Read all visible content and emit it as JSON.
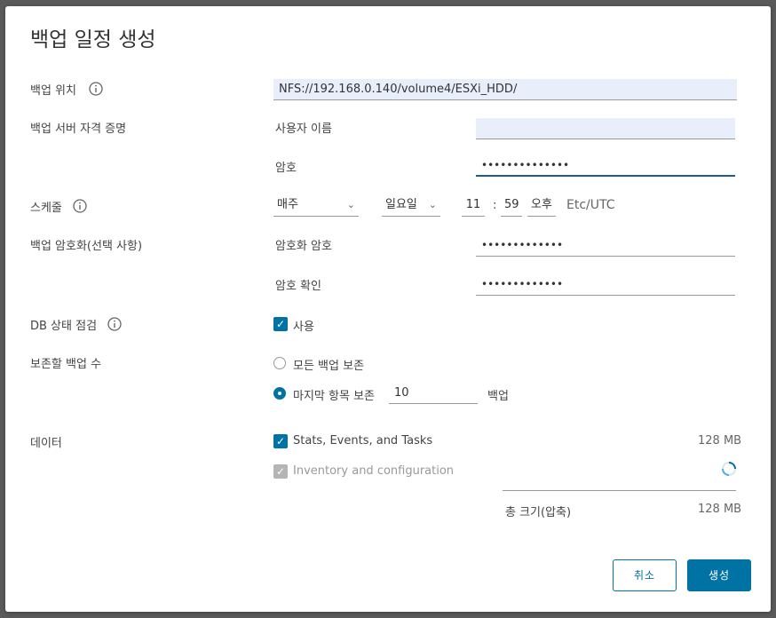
{
  "dialog": {
    "title": "백업 일정 생성",
    "location": {
      "label": "백업 위치",
      "value": "NFS://192.168.0.140/volume4/ESXi_HDD/"
    },
    "credentials": {
      "label": "백업 서버 자격 증명",
      "username_label": "사용자 이름",
      "username_value": "",
      "password_label": "암호",
      "password_value": "••••••••••••••"
    },
    "schedule": {
      "label": "스케줄",
      "frequency": "매주",
      "day": "일요일",
      "hour": "11",
      "separator": ":",
      "minute": "59",
      "ampm": "오후",
      "timezone": "Etc/UTC"
    },
    "encryption": {
      "label": "백업 암호화(선택 사항)",
      "password_label": "암호화 암호",
      "password_value": "•••••••••••••",
      "confirm_label": "암호 확인",
      "confirm_value": "•••••••••••••"
    },
    "db_check": {
      "label": "DB 상태 점검",
      "checkbox_label": "사용",
      "checked": true
    },
    "retention": {
      "label": "보존할 백업 수",
      "option_all": "모든 백업 보존",
      "option_last": "마지막 항목 보존",
      "last_count": "10",
      "unit": "백업"
    },
    "data": {
      "label": "데이터",
      "items": [
        {
          "label": "Stats, Events, and Tasks",
          "size": "128 MB",
          "checked": true,
          "disabled": false
        },
        {
          "label": "Inventory and configuration",
          "size": "",
          "checked": true,
          "disabled": true
        }
      ],
      "total_label": "총 크기(압축)",
      "total_size": "128 MB"
    },
    "buttons": {
      "cancel": "취소",
      "create": "생성"
    },
    "colors": {
      "accent": "#0072a3",
      "field_fill": "#e8effb"
    }
  }
}
